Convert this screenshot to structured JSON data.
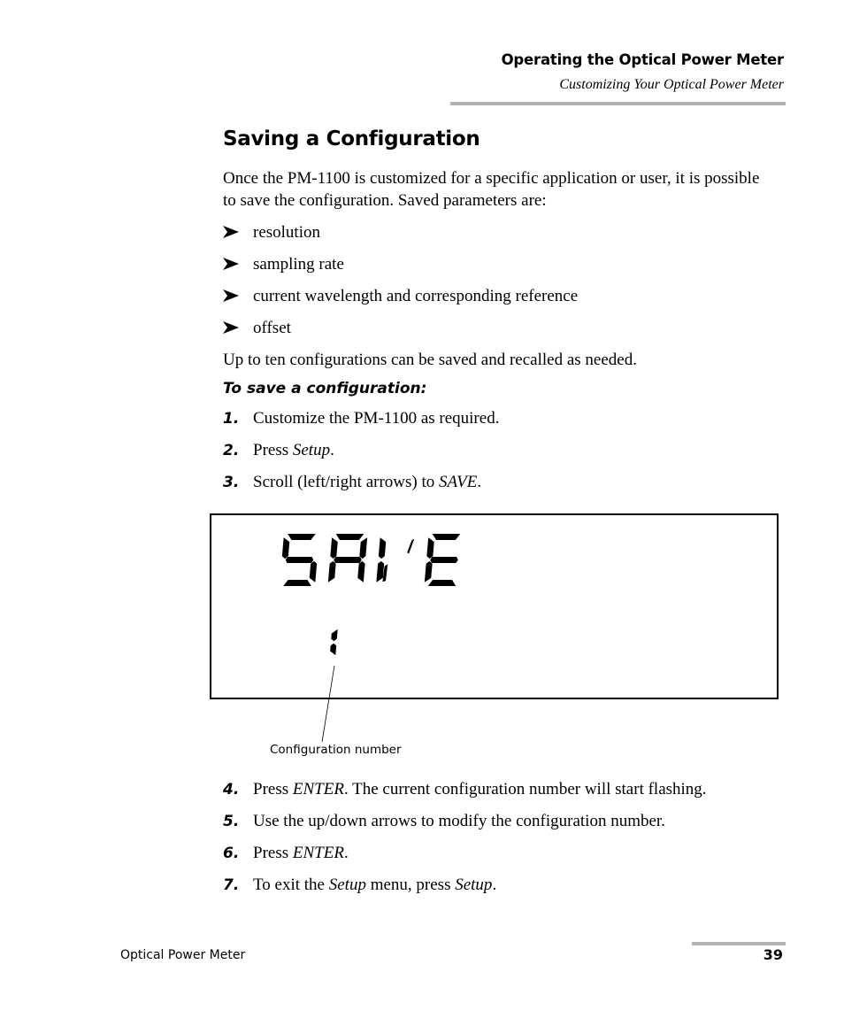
{
  "header": {
    "chapter": "Operating the Optical Power Meter",
    "section": "Customizing Your Optical Power Meter"
  },
  "section_title": "Saving a Configuration",
  "intro": "Once the PM-1100 is customized for a specific application or user, it is possible to save the configuration. Saved parameters are:",
  "bullet_icon": "arrowhead-bullet-icon",
  "saved_parameters": [
    "resolution",
    "sampling rate",
    "current wavelength and corresponding reference",
    "offset"
  ],
  "capacity_note": "Up to ten configurations can be saved and recalled as needed.",
  "procedure_title": "To save a configuration:",
  "steps_before_figure": [
    {
      "num": "1.",
      "pre": "Customize the PM-1100 as required.",
      "em": "",
      "post": ""
    },
    {
      "num": "2.",
      "pre": "Press ",
      "em": "Setup",
      "post": "."
    },
    {
      "num": "3.",
      "pre": "Scroll (left/right arrows) to ",
      "em": "SAVE",
      "post": "."
    }
  ],
  "display": {
    "main_text": "SAVE",
    "config_number": "1",
    "callout": "Configuration number"
  },
  "steps_after_figure": [
    {
      "num": "4.",
      "pre": "Press ",
      "em": "ENTER",
      "post": ". The current configuration number will start flashing.",
      "em2": "",
      "post2": ""
    },
    {
      "num": "5.",
      "pre": "Use the up/down arrows to modify the configuration number.",
      "em": "",
      "post": "",
      "em2": "",
      "post2": ""
    },
    {
      "num": "6.",
      "pre": "Press ",
      "em": "ENTER",
      "post": ".",
      "em2": "",
      "post2": ""
    },
    {
      "num": "7.",
      "pre": "To exit the ",
      "em": "Setup",
      "post": " menu, press ",
      "em2": "Setup",
      "post2": "."
    }
  ],
  "footer": {
    "title": "Optical Power Meter",
    "page": "39"
  }
}
